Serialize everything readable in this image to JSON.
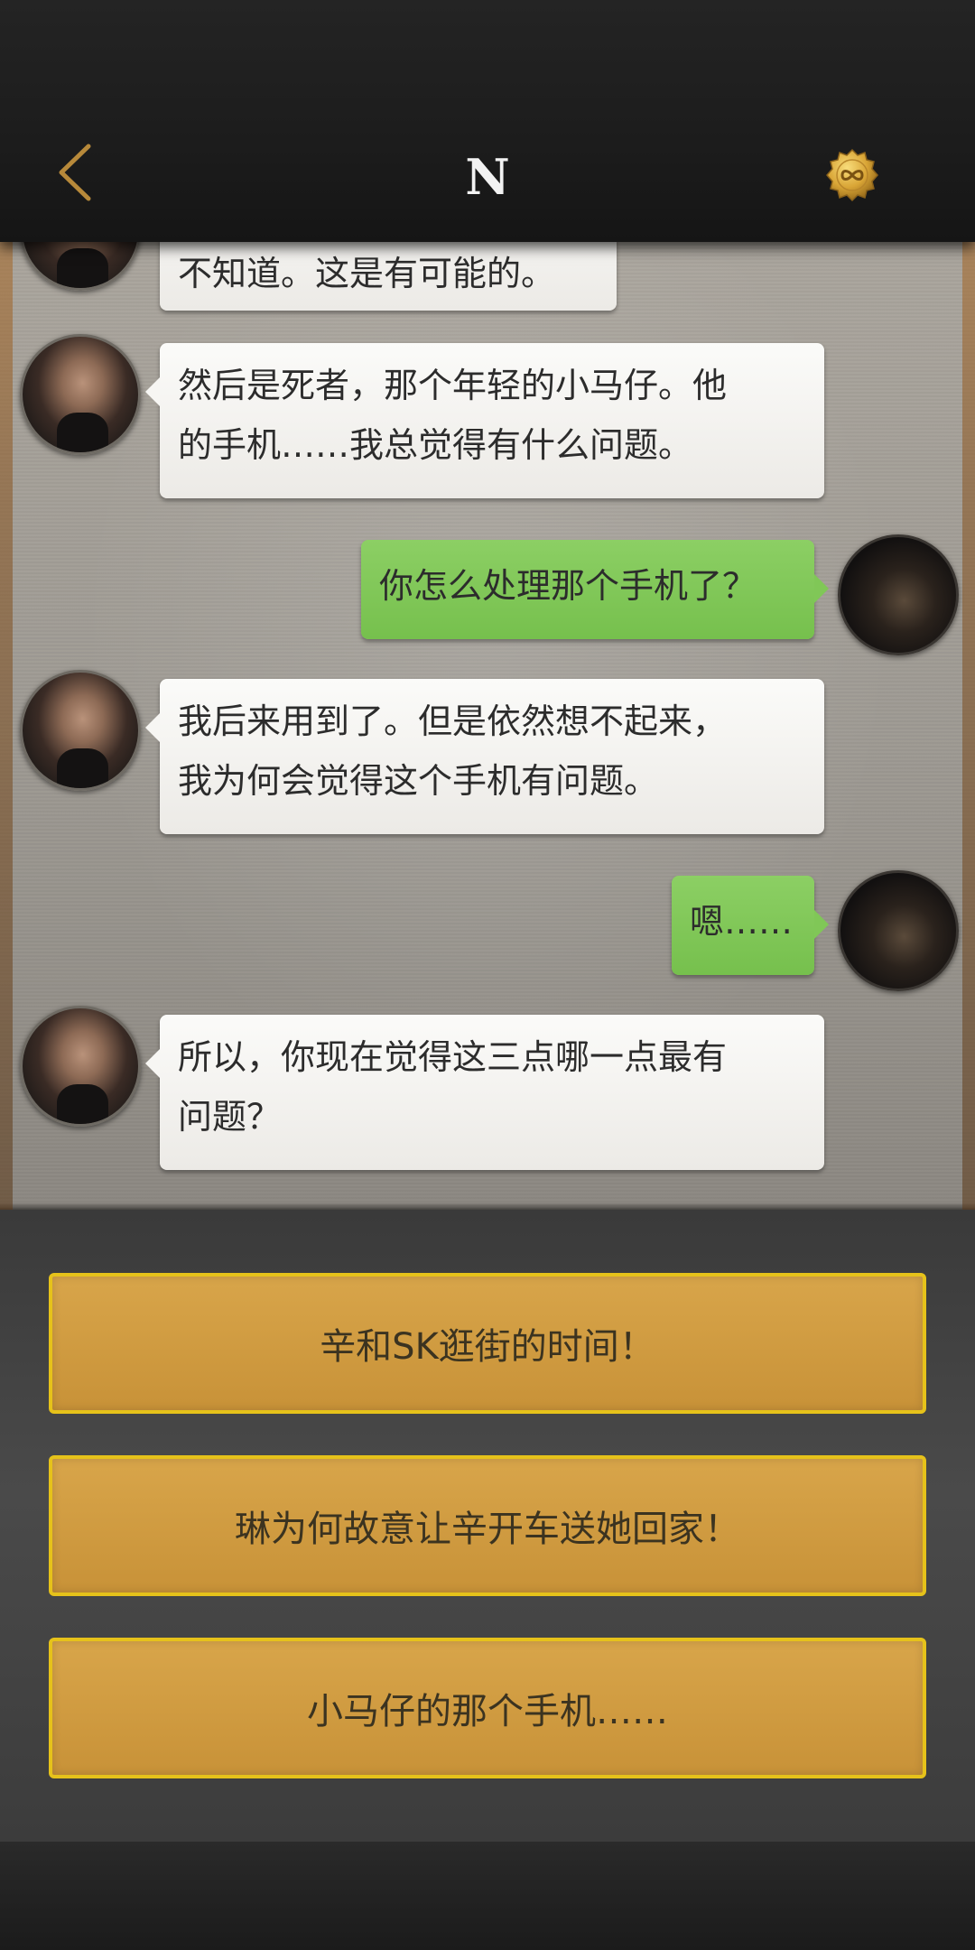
{
  "header": {
    "title": "N",
    "back_icon": "chevron-left-icon",
    "coin_icon": "infinity-coin-icon",
    "accent_color": "#c8962f"
  },
  "messages": [
    {
      "from": "npc",
      "text": "不知道。这是有可能的。"
    },
    {
      "from": "npc",
      "text": "然后是死者，那个年轻的小马仔。他\n的手机……我总觉得有什么问题。"
    },
    {
      "from": "me",
      "text": "你怎么处理那个手机了？"
    },
    {
      "from": "npc",
      "text": "我后来用到了。但是依然想不起来，\n我为何会觉得这个手机有问题。"
    },
    {
      "from": "me",
      "text": "嗯……"
    },
    {
      "from": "npc",
      "text": "所以，你现在觉得这三点哪一点最有\n问题？"
    }
  ],
  "choices": [
    {
      "label": "辛和SK逛街的时间！"
    },
    {
      "label": "琳为何故意让辛开车送她回家！"
    },
    {
      "label": "小马仔的那个手机……"
    }
  ],
  "colors": {
    "incoming_bubble": "#f4f3f0",
    "outgoing_bubble": "#7dc455",
    "choice_fill": "#d09c40",
    "choice_border": "#e6c21a"
  }
}
